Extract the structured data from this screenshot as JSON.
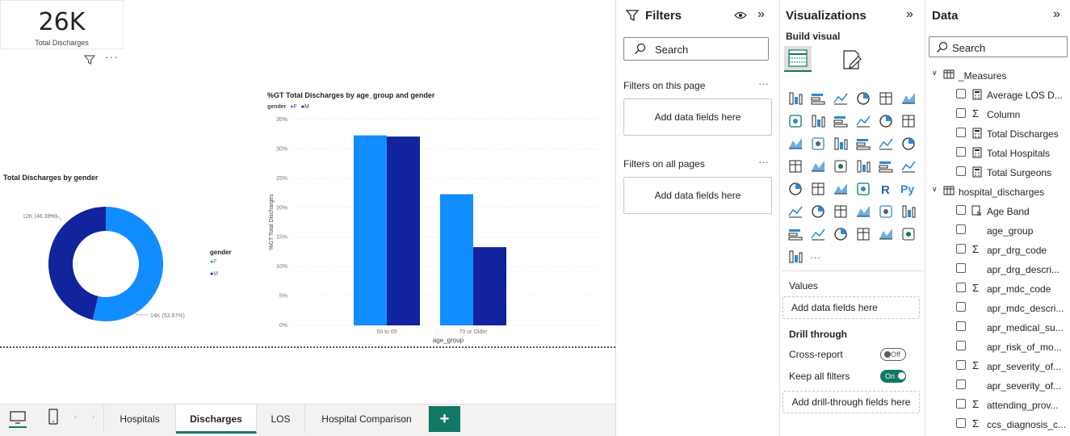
{
  "kpi": {
    "value": "26K",
    "label": "Total Discharges"
  },
  "donut": {
    "title": "Total Discharges by gender",
    "legend_title": "gender",
    "legend": [
      "F",
      "M"
    ],
    "label_m": "12K (46.33%)",
    "label_f": "14K (53.67%)"
  },
  "colors": {
    "F": "#118dff",
    "M": "#12239e",
    "accent": "#117865"
  },
  "chart_data": [
    {
      "type": "pie",
      "title": "Total Discharges by gender",
      "legend_title": "gender",
      "categories": [
        "F",
        "M"
      ],
      "values": [
        53.67,
        46.33
      ],
      "labels": [
        "14K (53.67%)",
        "12K (46.33%)"
      ]
    },
    {
      "type": "bar",
      "title": "%GT Total Discharges by age_group and gender",
      "legend_title": "gender",
      "categories": [
        "50 to 69",
        "70 or Older"
      ],
      "series": [
        {
          "name": "F",
          "values": [
            32.3,
            22.3
          ]
        },
        {
          "name": "M",
          "values": [
            32.1,
            13.3
          ]
        }
      ],
      "xlabel": "age_group",
      "ylabel": "%GT Total Discharges",
      "yticks": [
        "0%",
        "5%",
        "10%",
        "15%",
        "20%",
        "25%",
        "30%",
        "35%"
      ],
      "ylim": [
        0,
        35
      ]
    }
  ],
  "tabs": {
    "items": [
      "Hospitals",
      "Discharges",
      "LOS",
      "Hospital Comparison"
    ],
    "active": "Discharges",
    "add": "+"
  },
  "filters": {
    "title": "Filters",
    "search_placeholder": "Search",
    "on_page": "Filters on this page",
    "on_all": "Filters on all pages",
    "add_fields": "Add data fields here",
    "more": "···"
  },
  "visualizations": {
    "title": "Visualizations",
    "build": "Build visual",
    "values_label": "Values",
    "add_fields": "Add data fields here",
    "drill": "Drill through",
    "cross_report": "Cross-report",
    "cross_state": "Off",
    "keep_filters": "Keep all filters",
    "keep_state": "On",
    "add_drill": "Add drill-through fields here",
    "more": "···"
  },
  "data": {
    "title": "Data",
    "search_placeholder": "Search",
    "tables": [
      {
        "name": "_Measures",
        "items": [
          {
            "name": "Average LOS D...",
            "kind": "measure"
          },
          {
            "name": "Column",
            "kind": "sigma"
          },
          {
            "name": "Total Discharges",
            "kind": "measure"
          },
          {
            "name": "Total Hospitals",
            "kind": "measure"
          },
          {
            "name": "Total Surgeons",
            "kind": "measure"
          }
        ]
      },
      {
        "name": "hospital_discharges",
        "items": [
          {
            "name": "Age Band",
            "kind": "calc"
          },
          {
            "name": "age_group",
            "kind": "none"
          },
          {
            "name": "apr_drg_code",
            "kind": "sigma"
          },
          {
            "name": "apr_drg_descri...",
            "kind": "none"
          },
          {
            "name": "apr_mdc_code",
            "kind": "sigma"
          },
          {
            "name": "apr_mdc_descri...",
            "kind": "none"
          },
          {
            "name": "apr_medical_su...",
            "kind": "none"
          },
          {
            "name": "apr_risk_of_mo...",
            "kind": "none"
          },
          {
            "name": "apr_severity_of...",
            "kind": "sigma"
          },
          {
            "name": "apr_severity_of...",
            "kind": "none"
          },
          {
            "name": "attending_prov...",
            "kind": "sigma"
          },
          {
            "name": "ccs_diagnosis_c...",
            "kind": "sigma"
          }
        ]
      }
    ]
  }
}
